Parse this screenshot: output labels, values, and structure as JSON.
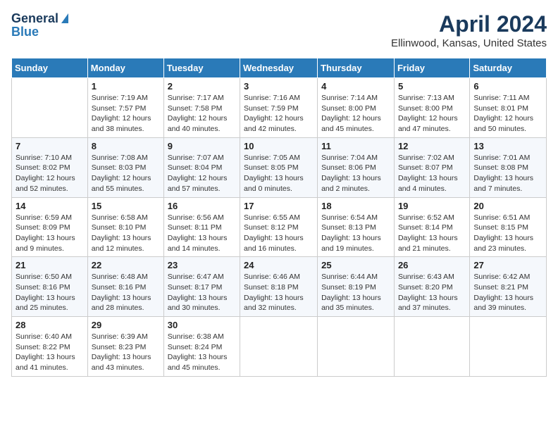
{
  "logo": {
    "line1": "General",
    "line2": "Blue"
  },
  "title": "April 2024",
  "subtitle": "Ellinwood, Kansas, United States",
  "weekdays": [
    "Sunday",
    "Monday",
    "Tuesday",
    "Wednesday",
    "Thursday",
    "Friday",
    "Saturday"
  ],
  "weeks": [
    [
      {
        "day": "",
        "info": ""
      },
      {
        "day": "1",
        "info": "Sunrise: 7:19 AM\nSunset: 7:57 PM\nDaylight: 12 hours\nand 38 minutes."
      },
      {
        "day": "2",
        "info": "Sunrise: 7:17 AM\nSunset: 7:58 PM\nDaylight: 12 hours\nand 40 minutes."
      },
      {
        "day": "3",
        "info": "Sunrise: 7:16 AM\nSunset: 7:59 PM\nDaylight: 12 hours\nand 42 minutes."
      },
      {
        "day": "4",
        "info": "Sunrise: 7:14 AM\nSunset: 8:00 PM\nDaylight: 12 hours\nand 45 minutes."
      },
      {
        "day": "5",
        "info": "Sunrise: 7:13 AM\nSunset: 8:00 PM\nDaylight: 12 hours\nand 47 minutes."
      },
      {
        "day": "6",
        "info": "Sunrise: 7:11 AM\nSunset: 8:01 PM\nDaylight: 12 hours\nand 50 minutes."
      }
    ],
    [
      {
        "day": "7",
        "info": "Sunrise: 7:10 AM\nSunset: 8:02 PM\nDaylight: 12 hours\nand 52 minutes."
      },
      {
        "day": "8",
        "info": "Sunrise: 7:08 AM\nSunset: 8:03 PM\nDaylight: 12 hours\nand 55 minutes."
      },
      {
        "day": "9",
        "info": "Sunrise: 7:07 AM\nSunset: 8:04 PM\nDaylight: 12 hours\nand 57 minutes."
      },
      {
        "day": "10",
        "info": "Sunrise: 7:05 AM\nSunset: 8:05 PM\nDaylight: 13 hours\nand 0 minutes."
      },
      {
        "day": "11",
        "info": "Sunrise: 7:04 AM\nSunset: 8:06 PM\nDaylight: 13 hours\nand 2 minutes."
      },
      {
        "day": "12",
        "info": "Sunrise: 7:02 AM\nSunset: 8:07 PM\nDaylight: 13 hours\nand 4 minutes."
      },
      {
        "day": "13",
        "info": "Sunrise: 7:01 AM\nSunset: 8:08 PM\nDaylight: 13 hours\nand 7 minutes."
      }
    ],
    [
      {
        "day": "14",
        "info": "Sunrise: 6:59 AM\nSunset: 8:09 PM\nDaylight: 13 hours\nand 9 minutes."
      },
      {
        "day": "15",
        "info": "Sunrise: 6:58 AM\nSunset: 8:10 PM\nDaylight: 13 hours\nand 12 minutes."
      },
      {
        "day": "16",
        "info": "Sunrise: 6:56 AM\nSunset: 8:11 PM\nDaylight: 13 hours\nand 14 minutes."
      },
      {
        "day": "17",
        "info": "Sunrise: 6:55 AM\nSunset: 8:12 PM\nDaylight: 13 hours\nand 16 minutes."
      },
      {
        "day": "18",
        "info": "Sunrise: 6:54 AM\nSunset: 8:13 PM\nDaylight: 13 hours\nand 19 minutes."
      },
      {
        "day": "19",
        "info": "Sunrise: 6:52 AM\nSunset: 8:14 PM\nDaylight: 13 hours\nand 21 minutes."
      },
      {
        "day": "20",
        "info": "Sunrise: 6:51 AM\nSunset: 8:15 PM\nDaylight: 13 hours\nand 23 minutes."
      }
    ],
    [
      {
        "day": "21",
        "info": "Sunrise: 6:50 AM\nSunset: 8:16 PM\nDaylight: 13 hours\nand 25 minutes."
      },
      {
        "day": "22",
        "info": "Sunrise: 6:48 AM\nSunset: 8:16 PM\nDaylight: 13 hours\nand 28 minutes."
      },
      {
        "day": "23",
        "info": "Sunrise: 6:47 AM\nSunset: 8:17 PM\nDaylight: 13 hours\nand 30 minutes."
      },
      {
        "day": "24",
        "info": "Sunrise: 6:46 AM\nSunset: 8:18 PM\nDaylight: 13 hours\nand 32 minutes."
      },
      {
        "day": "25",
        "info": "Sunrise: 6:44 AM\nSunset: 8:19 PM\nDaylight: 13 hours\nand 35 minutes."
      },
      {
        "day": "26",
        "info": "Sunrise: 6:43 AM\nSunset: 8:20 PM\nDaylight: 13 hours\nand 37 minutes."
      },
      {
        "day": "27",
        "info": "Sunrise: 6:42 AM\nSunset: 8:21 PM\nDaylight: 13 hours\nand 39 minutes."
      }
    ],
    [
      {
        "day": "28",
        "info": "Sunrise: 6:40 AM\nSunset: 8:22 PM\nDaylight: 13 hours\nand 41 minutes."
      },
      {
        "day": "29",
        "info": "Sunrise: 6:39 AM\nSunset: 8:23 PM\nDaylight: 13 hours\nand 43 minutes."
      },
      {
        "day": "30",
        "info": "Sunrise: 6:38 AM\nSunset: 8:24 PM\nDaylight: 13 hours\nand 45 minutes."
      },
      {
        "day": "",
        "info": ""
      },
      {
        "day": "",
        "info": ""
      },
      {
        "day": "",
        "info": ""
      },
      {
        "day": "",
        "info": ""
      }
    ]
  ]
}
